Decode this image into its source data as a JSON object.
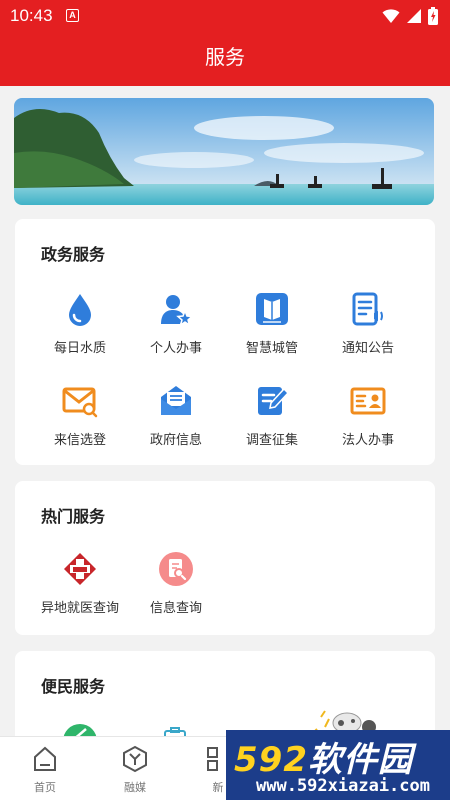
{
  "status_bar": {
    "time": "10:43",
    "notification_glyph": "A"
  },
  "header": {
    "title": "服务"
  },
  "sections": {
    "gov": {
      "title": "政务服务",
      "items": [
        {
          "label": "每日水质",
          "icon": "water-drop-icon"
        },
        {
          "label": "个人办事",
          "icon": "person-star-icon"
        },
        {
          "label": "智慧城管",
          "icon": "book-icon"
        },
        {
          "label": "通知公告",
          "icon": "notice-speaker-icon"
        },
        {
          "label": "来信选登",
          "icon": "mail-search-icon"
        },
        {
          "label": "政府信息",
          "icon": "open-mail-icon"
        },
        {
          "label": "调查征集",
          "icon": "edit-document-icon"
        },
        {
          "label": "法人办事",
          "icon": "id-card-icon"
        }
      ]
    },
    "hot": {
      "title": "热门服务",
      "items": [
        {
          "label": "异地就医查询",
          "icon": "medical-cross-icon"
        },
        {
          "label": "信息查询",
          "icon": "document-search-icon"
        }
      ]
    },
    "life": {
      "title": "便民服务"
    }
  },
  "bottom_nav": [
    {
      "label": "首页",
      "icon": "home-icon"
    },
    {
      "label": "融媒",
      "icon": "cube-icon"
    },
    {
      "label": "新",
      "icon": "grid-icon"
    }
  ],
  "watermark": {
    "brand_num": "592",
    "brand_text": "软件园",
    "url": "www.592xiazai.com"
  },
  "colors": {
    "brand_red": "#e41f21",
    "icon_blue": "#2f7ddb",
    "icon_orange": "#f08c1e"
  }
}
